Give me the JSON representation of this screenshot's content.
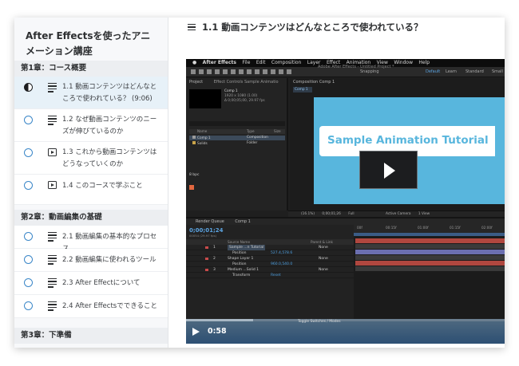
{
  "sidebar": {
    "course_title": "After Effectsを使ったアニメーション講座",
    "sections": [
      {
        "title": "第1章：コース概要",
        "lessons": [
          {
            "text": "1.1 動画コンテンツはどんなところで使われている？ (9:06)",
            "type": "article",
            "status": "in-progress",
            "active": true
          },
          {
            "text": "1.2 なぜ動画コンテンツのニーズが伸びているのか",
            "type": "article",
            "status": "not-started",
            "active": false
          },
          {
            "text": "1.3 これから動画コンテンツはどうなっていくのか",
            "type": "video",
            "status": "not-started",
            "active": false
          },
          {
            "text": "1.4 このコースで学ぶこと",
            "type": "video",
            "status": "not-started",
            "active": false
          }
        ]
      },
      {
        "title": "第2章：動画編集の基礎",
        "lessons": [
          {
            "text": "2.1 動画編集の基本的なプロセス",
            "type": "article",
            "status": "not-started"
          },
          {
            "text": "2.2 動画編集に使われるツール",
            "type": "article",
            "status": "not-started"
          },
          {
            "text": "2.3 After Effectについて",
            "type": "article",
            "status": "not-started"
          },
          {
            "text": "2.4 After Effectsでできること",
            "type": "article",
            "status": "not-started"
          }
        ]
      },
      {
        "title": "第3章：下準備",
        "lessons": []
      }
    ]
  },
  "main": {
    "lesson_title": "1.1 動画コンテンツはどんなところで使われている？"
  },
  "video": {
    "time": "0:58",
    "progress": 0.21,
    "menubar": [
      "After Effects",
      "File",
      "Edit",
      "Composition",
      "Layer",
      "Effect",
      "Animation",
      "View",
      "Window",
      "Help"
    ],
    "window_title": "Adobe After Effects - Untitled Project *",
    "snapping_label": "Snapping",
    "workspaces": [
      "Default",
      "Learn",
      "Standard",
      "Small"
    ],
    "project_tab": "Project",
    "effect_controls_tab": "Effect Controls Sample Animatio",
    "comp_name": "Comp 1",
    "comp_meta_1": "1920 x 1080 (1.00)",
    "comp_meta_2": "Δ 0;00;05;00, 29.97 fps",
    "col_name": "Name",
    "col_type": "Type",
    "col_size": "Size",
    "project_rows": [
      {
        "name": "Comp 1",
        "type": "Composition"
      },
      {
        "name": "Solids",
        "type": "Folder"
      }
    ],
    "bpc": "8 bpc",
    "composition_tab": "Composition Comp 1",
    "comp_subtab": "Comp 1",
    "banner_text": "Sample Animation Tutorial",
    "comp_bar": [
      "(16.1%)",
      "0;00;01;26",
      "Full",
      "Active Camera",
      "1 View"
    ],
    "render_queue_tab": "Render Queue",
    "timeline_tab": "Comp 1",
    "timecode": "0;00;01;24",
    "timecode_sub": "00054 (29.97 fps)",
    "tl_col_source": "Source Name",
    "tl_col_parent": "Parent & Link",
    "layers": [
      {
        "num": "1",
        "name": "Sample ...n Tutorial",
        "value": "",
        "mode": "None",
        "color": "#c84a4a"
      },
      {
        "num": "",
        "name": "Position",
        "value": "527.4,578.6",
        "mode": "",
        "color": ""
      },
      {
        "num": "2",
        "name": "Shape Layer 1",
        "value": "",
        "mode": "None",
        "color": "#c84a4a"
      },
      {
        "num": "",
        "name": "Position",
        "value": "960.0,540.0",
        "mode": "",
        "color": ""
      },
      {
        "num": "3",
        "name": "Medium ...Solid 1",
        "value": "",
        "mode": "None",
        "color": "#c84a4a"
      },
      {
        "num": "",
        "name": "Transform",
        "value": "Reset",
        "mode": "",
        "color": ""
      }
    ],
    "ruler_ticks": [
      "00f",
      "00:15f",
      "01:00f",
      "01:15f",
      "02:00f"
    ],
    "toggle_label": "Toggle Switches / Modes",
    "colors": {
      "comp_bg": "#58b6dd",
      "timeline_bar_red": "#b0473f",
      "timeline_bar_purple": "#6b6fb0",
      "progress_blue": "#2d4f73"
    }
  }
}
